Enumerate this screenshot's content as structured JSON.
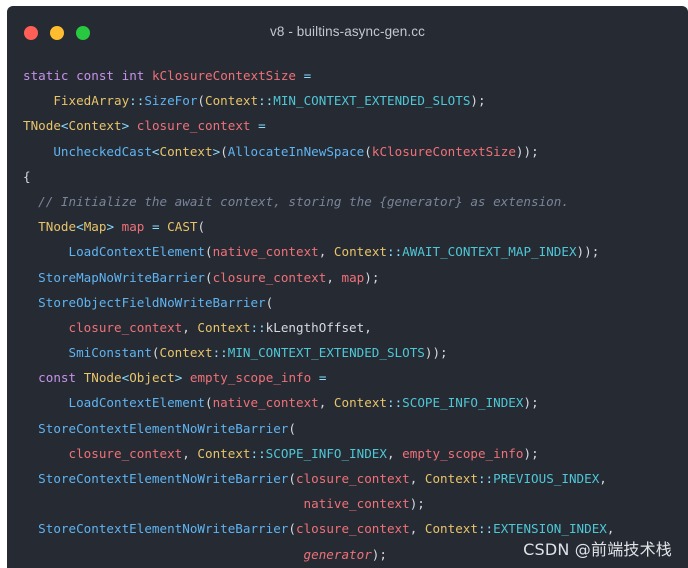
{
  "window": {
    "title": "v8 - builtins-async-gen.cc"
  },
  "colors": {
    "window_background": "#252a33",
    "keyword": "#c792ea",
    "type": "#e8c46a",
    "variable": "#f07178",
    "function": "#5fb4f2",
    "constant": "#4fc7d6",
    "punctuation": "#89ddff",
    "plain": "#d6d9df",
    "comment": "#7b8598"
  },
  "code": {
    "lines": [
      [
        [
          "kw",
          "static"
        ],
        [
          "plain",
          " "
        ],
        [
          "kw",
          "const"
        ],
        [
          "plain",
          " "
        ],
        [
          "kw",
          "int"
        ],
        [
          "plain",
          " "
        ],
        [
          "var",
          "kClosureContextSize"
        ],
        [
          "plain",
          " "
        ],
        [
          "punc",
          "="
        ]
      ],
      [
        [
          "plain",
          "    "
        ],
        [
          "type",
          "FixedArray"
        ],
        [
          "punc",
          "::"
        ],
        [
          "fn",
          "SizeFor"
        ],
        [
          "plain",
          "("
        ],
        [
          "type",
          "Context"
        ],
        [
          "punc",
          "::"
        ],
        [
          "const",
          "MIN_CONTEXT_EXTENDED_SLOTS"
        ],
        [
          "plain",
          ");"
        ]
      ],
      [
        [
          "type",
          "TNode"
        ],
        [
          "punc",
          "<"
        ],
        [
          "type",
          "Context"
        ],
        [
          "punc",
          ">"
        ],
        [
          "plain",
          " "
        ],
        [
          "var",
          "closure_context"
        ],
        [
          "plain",
          " "
        ],
        [
          "punc",
          "="
        ]
      ],
      [
        [
          "plain",
          "    "
        ],
        [
          "fn",
          "UncheckedCast"
        ],
        [
          "punc",
          "<"
        ],
        [
          "type",
          "Context"
        ],
        [
          "punc",
          ">"
        ],
        [
          "plain",
          "("
        ],
        [
          "fn",
          "AllocateInNewSpace"
        ],
        [
          "plain",
          "("
        ],
        [
          "var",
          "kClosureContextSize"
        ],
        [
          "plain",
          "));"
        ]
      ],
      [
        [
          "plain",
          "{"
        ]
      ],
      [
        [
          "plain",
          "  "
        ],
        [
          "comment",
          "// Initialize the await context, storing the {generator} as extension."
        ]
      ],
      [
        [
          "plain",
          "  "
        ],
        [
          "type",
          "TNode"
        ],
        [
          "punc",
          "<"
        ],
        [
          "type",
          "Map"
        ],
        [
          "punc",
          ">"
        ],
        [
          "plain",
          " "
        ],
        [
          "var",
          "map"
        ],
        [
          "plain",
          " "
        ],
        [
          "punc",
          "="
        ],
        [
          "plain",
          " "
        ],
        [
          "type",
          "CAST"
        ],
        [
          "plain",
          "("
        ]
      ],
      [
        [
          "plain",
          "      "
        ],
        [
          "fn",
          "LoadContextElement"
        ],
        [
          "plain",
          "("
        ],
        [
          "var",
          "native_context"
        ],
        [
          "plain",
          ", "
        ],
        [
          "type",
          "Context"
        ],
        [
          "punc",
          "::"
        ],
        [
          "const",
          "AWAIT_CONTEXT_MAP_INDEX"
        ],
        [
          "plain",
          "));"
        ]
      ],
      [
        [
          "plain",
          "  "
        ],
        [
          "fn",
          "StoreMapNoWriteBarrier"
        ],
        [
          "plain",
          "("
        ],
        [
          "var",
          "closure_context"
        ],
        [
          "plain",
          ", "
        ],
        [
          "var",
          "map"
        ],
        [
          "plain",
          ");"
        ]
      ],
      [
        [
          "plain",
          "  "
        ],
        [
          "fn",
          "StoreObjectFieldNoWriteBarrier"
        ],
        [
          "plain",
          "("
        ]
      ],
      [
        [
          "plain",
          "      "
        ],
        [
          "var",
          "closure_context"
        ],
        [
          "plain",
          ", "
        ],
        [
          "type",
          "Context"
        ],
        [
          "punc",
          "::"
        ],
        [
          "plain",
          "kLengthOffset,"
        ]
      ],
      [
        [
          "plain",
          "      "
        ],
        [
          "fn",
          "SmiConstant"
        ],
        [
          "plain",
          "("
        ],
        [
          "type",
          "Context"
        ],
        [
          "punc",
          "::"
        ],
        [
          "const",
          "MIN_CONTEXT_EXTENDED_SLOTS"
        ],
        [
          "plain",
          "));"
        ]
      ],
      [
        [
          "plain",
          "  "
        ],
        [
          "kw",
          "const"
        ],
        [
          "plain",
          " "
        ],
        [
          "type",
          "TNode"
        ],
        [
          "punc",
          "<"
        ],
        [
          "type",
          "Object"
        ],
        [
          "punc",
          ">"
        ],
        [
          "plain",
          " "
        ],
        [
          "var",
          "empty_scope_info"
        ],
        [
          "plain",
          " "
        ],
        [
          "punc",
          "="
        ]
      ],
      [
        [
          "plain",
          "      "
        ],
        [
          "fn",
          "LoadContextElement"
        ],
        [
          "plain",
          "("
        ],
        [
          "var",
          "native_context"
        ],
        [
          "plain",
          ", "
        ],
        [
          "type",
          "Context"
        ],
        [
          "punc",
          "::"
        ],
        [
          "const",
          "SCOPE_INFO_INDEX"
        ],
        [
          "plain",
          ");"
        ]
      ],
      [
        [
          "plain",
          "  "
        ],
        [
          "fn",
          "StoreContextElementNoWriteBarrier"
        ],
        [
          "plain",
          "("
        ]
      ],
      [
        [
          "plain",
          "      "
        ],
        [
          "var",
          "closure_context"
        ],
        [
          "plain",
          ", "
        ],
        [
          "type",
          "Context"
        ],
        [
          "punc",
          "::"
        ],
        [
          "const",
          "SCOPE_INFO_INDEX"
        ],
        [
          "plain",
          ", "
        ],
        [
          "var",
          "empty_scope_info"
        ],
        [
          "plain",
          ");"
        ]
      ],
      [
        [
          "plain",
          "  "
        ],
        [
          "fn",
          "StoreContextElementNoWriteBarrier"
        ],
        [
          "plain",
          "("
        ],
        [
          "var",
          "closure_context"
        ],
        [
          "plain",
          ", "
        ],
        [
          "type",
          "Context"
        ],
        [
          "punc",
          "::"
        ],
        [
          "const",
          "PREVIOUS_INDEX"
        ],
        [
          "plain",
          ","
        ]
      ],
      [
        [
          "plain",
          "                                     "
        ],
        [
          "var",
          "native_context"
        ],
        [
          "plain",
          ");"
        ]
      ],
      [
        [
          "plain",
          "  "
        ],
        [
          "fn",
          "StoreContextElementNoWriteBarrier"
        ],
        [
          "plain",
          "("
        ],
        [
          "var",
          "closure_context"
        ],
        [
          "plain",
          ", "
        ],
        [
          "type",
          "Context"
        ],
        [
          "punc",
          "::"
        ],
        [
          "const",
          "EXTENSION_INDEX"
        ],
        [
          "plain",
          ","
        ]
      ],
      [
        [
          "plain",
          "                                     "
        ],
        [
          "param",
          "generator"
        ],
        [
          "plain",
          ");"
        ]
      ]
    ]
  },
  "watermark": {
    "text": "CSDN @前端技术栈"
  }
}
